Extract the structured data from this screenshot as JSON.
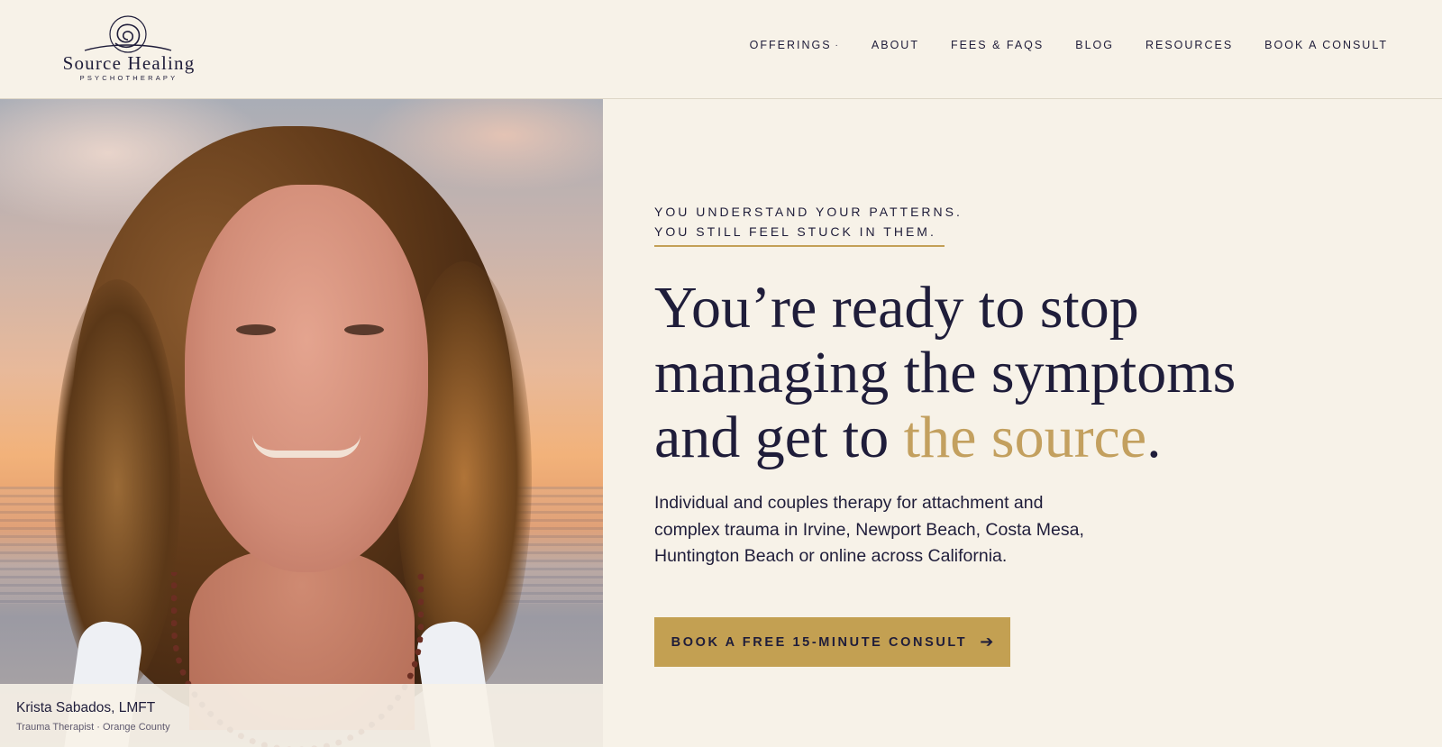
{
  "brand": {
    "name": "Source Healing",
    "tagline": "PSYCHOTHERAPY"
  },
  "nav": {
    "items": [
      {
        "label": "OFFERINGS",
        "caret": "·"
      },
      {
        "label": "ABOUT"
      },
      {
        "label": "FEES & FAQS"
      },
      {
        "label": "BLOG"
      },
      {
        "label": "RESOURCES"
      },
      {
        "label": "BOOK A CONSULT"
      }
    ]
  },
  "hero": {
    "eyebrow_line1": "YOU UNDERSTAND YOUR PATTERNS.",
    "eyebrow_line2": "YOU STILL FEEL STUCK IN THEM.",
    "headline_line1": "You’re ready to stop",
    "headline_line2": "managing the symptoms",
    "headline_line3_prefix": "and get to ",
    "headline_accent": "the source",
    "headline_suffix": ".",
    "subtext": "Individual and couples therapy for attachment and complex trauma in Irvine, Newport Beach, Costa Mesa, Huntington Beach or online across California.",
    "cta_label": "BOOK A FREE 15-MINUTE CONSULT",
    "cta_icon": "arrow-right-icon"
  },
  "photo": {
    "caption_name": "Krista Sabados, LMFT",
    "caption_role": "Trauma Therapist · Orange County"
  },
  "colors": {
    "background": "#f7f2e8",
    "navy": "#1f1d3a",
    "gold": "#c3a052",
    "accent_text": "#c3a05f"
  }
}
